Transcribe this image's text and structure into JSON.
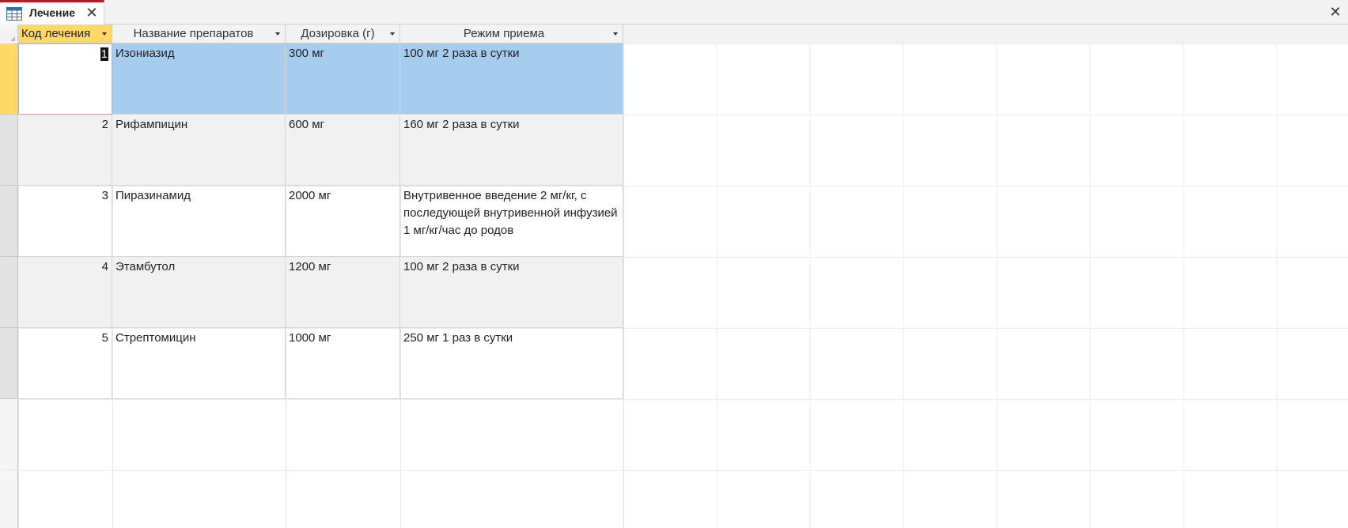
{
  "tab": {
    "title": "Лечение",
    "icon": "table-icon"
  },
  "columns": [
    {
      "key": "id",
      "label": "Код лечения"
    },
    {
      "key": "name",
      "label": "Название препаратов"
    },
    {
      "key": "dose",
      "label": "Дозировка (г)"
    },
    {
      "key": "regimen",
      "label": "Режим приема"
    }
  ],
  "rows": [
    {
      "id": "1",
      "name": "Изониазид",
      "dose": "300 мг",
      "regimen": "100 мг 2 раза в сутки"
    },
    {
      "id": "2",
      "name": "Рифампицин",
      "dose": "600 мг",
      "regimen": "160 мг 2 раза в сутки"
    },
    {
      "id": "3",
      "name": "Пиразинамид",
      "dose": "2000 мг",
      "regimen": "Внутривенное введение 2 мг/кг, с последующей внутривенной инфузией 1 мг/кг/час до родов"
    },
    {
      "id": "4",
      "name": "Этамбутол",
      "dose": "1200 мг",
      "regimen": "100 мг 2 раза в сутки"
    },
    {
      "id": "5",
      "name": "Стрептомицин",
      "dose": "1000 мг",
      "regimen": "250 мг 1 раз в сутки"
    }
  ],
  "selected_row": 1,
  "colors": {
    "header_active": "#ffd966",
    "selection": "#a6cdee",
    "tab_accent": "#a4262c"
  }
}
